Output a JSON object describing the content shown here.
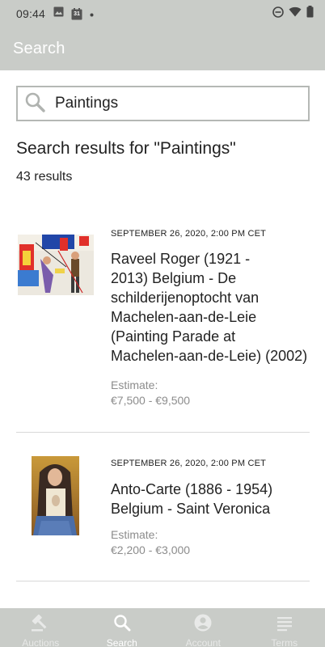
{
  "status_bar": {
    "time": "09:44",
    "calendar_day": "31",
    "icons": [
      "image-icon",
      "calendar-icon",
      "dot-icon",
      "do-not-disturb-icon",
      "wifi-icon",
      "battery-icon"
    ]
  },
  "app_bar": {
    "title": "Search"
  },
  "search": {
    "value": "Paintings",
    "icon": "search-icon"
  },
  "results": {
    "heading": "Search results for \"Paintings\"",
    "count": "43 results",
    "items": [
      {
        "date": "SEPTEMBER 26, 2020, 2:00 PM CET",
        "title_lines": [
          "Raveel Roger (1921 -",
          "2013) Belgium - De",
          "schilderijenoptocht van",
          "Machelen-aan-de-Leie",
          "(Painting Parade at",
          "Machelen-aan-de-Leie) (2002)"
        ],
        "estimate_label": "Estimate:",
        "estimate_value": "€7,500 - €9,500"
      },
      {
        "date": "SEPTEMBER 26, 2020, 2:00 PM CET",
        "title_lines": [
          "Anto-Carte (1886 - 1954)",
          "Belgium - Saint Veronica"
        ],
        "estimate_label": "Estimate:",
        "estimate_value": "€2,200 - €3,000"
      }
    ]
  },
  "bottom_nav": {
    "items": [
      {
        "label": "Auctions",
        "icon": "gavel-icon",
        "active": false
      },
      {
        "label": "Search",
        "icon": "search-icon",
        "active": true
      },
      {
        "label": "Account",
        "icon": "account-circle-icon",
        "active": false
      },
      {
        "label": "Terms",
        "icon": "document-lines-icon",
        "active": false
      }
    ]
  },
  "colors": {
    "chrome": "#c9ccc8",
    "border": "#b5b8b5",
    "muted_text": "#8c8c8c"
  }
}
